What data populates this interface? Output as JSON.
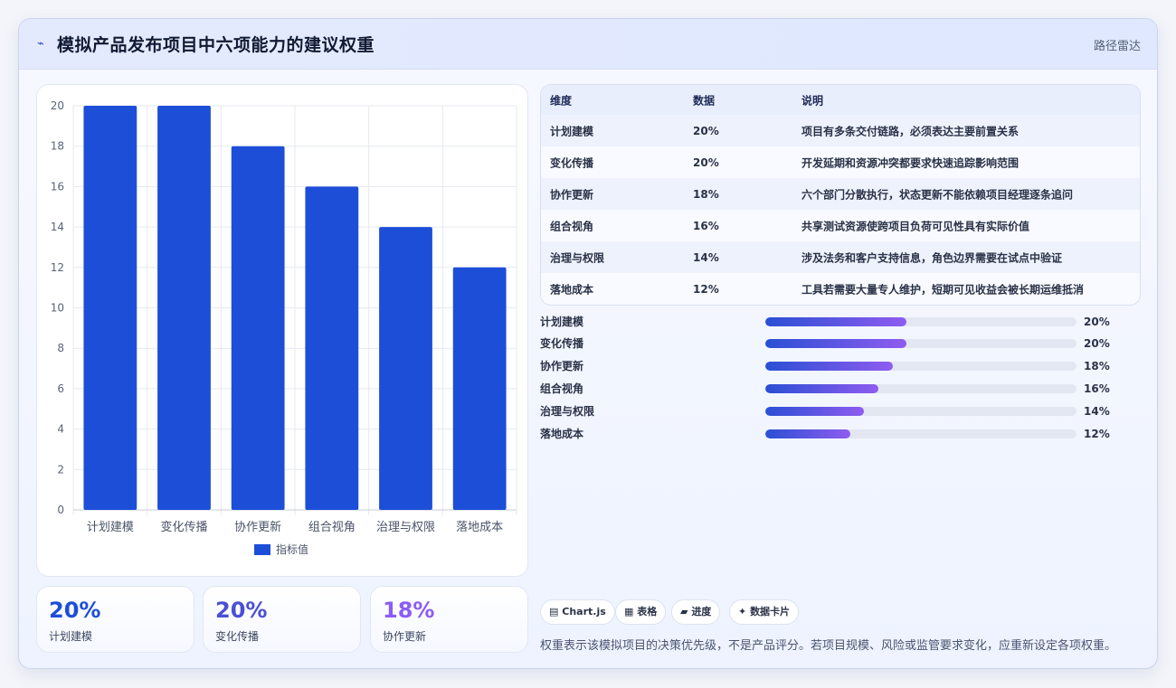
{
  "header": {
    "icon": "pulse-icon",
    "title": "模拟产品发布项目中六项能力的建议权重",
    "tag": "路径雷达"
  },
  "chart_data": {
    "type": "bar",
    "categories": [
      "计划建模",
      "变化传播",
      "协作更新",
      "组合视角",
      "治理与权限",
      "落地成本"
    ],
    "series": [
      {
        "name": "指标值",
        "values": [
          20,
          20,
          18,
          16,
          14,
          12
        ],
        "color": "#1c4ed8"
      }
    ],
    "ylim": [
      0,
      20
    ],
    "yticks": [
      0,
      2,
      4,
      6,
      8,
      10,
      12,
      14,
      16,
      18,
      20
    ],
    "grid": true,
    "legend": "bottom"
  },
  "stats": [
    {
      "value": "20%",
      "label": "计划建模",
      "color": "#1c4ed8"
    },
    {
      "value": "20%",
      "label": "变化传播",
      "color": "#4a4fd6"
    },
    {
      "value": "18%",
      "label": "协作更新",
      "color": "#8b5cf6"
    }
  ],
  "table": {
    "headers": [
      "维度",
      "数据",
      "说明"
    ],
    "rows": [
      {
        "dim": "计划建模",
        "value": "20%",
        "note": "项目有多条交付链路，必须表达主要前置关系"
      },
      {
        "dim": "变化传播",
        "value": "20%",
        "note": "开发延期和资源冲突都要求快速追踪影响范围"
      },
      {
        "dim": "协作更新",
        "value": "18%",
        "note": "六个部门分散执行，状态更新不能依赖项目经理逐条追问"
      },
      {
        "dim": "组合视角",
        "value": "16%",
        "note": "共享测试资源使跨项目负荷可见性具有实际价值"
      },
      {
        "dim": "治理与权限",
        "value": "14%",
        "note": "涉及法务和客户支持信息，角色边界需要在试点中验证"
      },
      {
        "dim": "落地成本",
        "value": "12%",
        "note": "工具若需要大量专人维护，短期可见收益会被长期运维抵消"
      }
    ]
  },
  "progress": [
    {
      "label": "计划建模",
      "value": 20,
      "text": "20%"
    },
    {
      "label": "变化传播",
      "value": 20,
      "text": "20%"
    },
    {
      "label": "协作更新",
      "value": 18,
      "text": "18%"
    },
    {
      "label": "组合视角",
      "value": 16,
      "text": "16%"
    },
    {
      "label": "治理与权限",
      "value": 14,
      "text": "14%"
    },
    {
      "label": "落地成本",
      "value": 12,
      "text": "12%"
    }
  ],
  "progress_max": 44,
  "chips": [
    {
      "icon": "chart-icon",
      "glyph": "▤",
      "label": "Chart.js"
    },
    {
      "icon": "table-icon",
      "glyph": "▦",
      "label": "表格"
    },
    {
      "icon": "progress-icon",
      "glyph": "▰",
      "label": "进度"
    },
    {
      "icon": "card-icon",
      "glyph": "✦",
      "label": "数据卡片"
    }
  ],
  "footnote": "权重表示该模拟项目的决策优先级，不是产品评分。若项目规模、风险或监管要求变化，应重新设定各项权重。"
}
